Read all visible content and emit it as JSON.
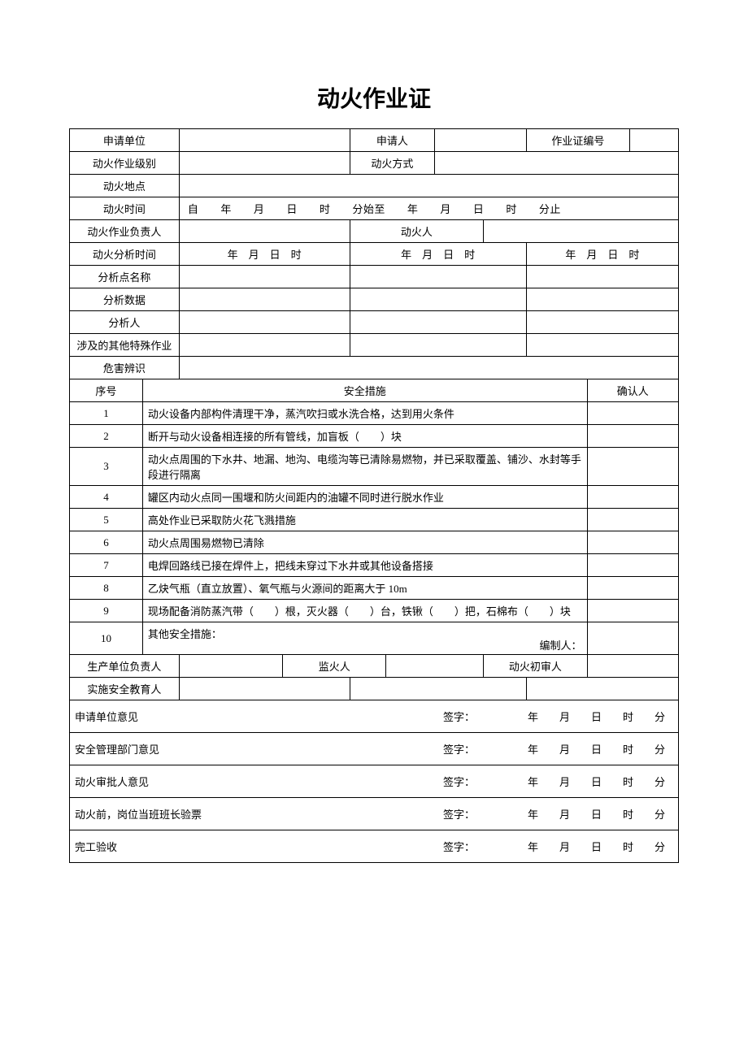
{
  "title": "动火作业证",
  "labels": {
    "applicant_unit": "申请单位",
    "applicant": "申请人",
    "permit_no": "作业证编号",
    "level": "动火作业级别",
    "method": "动火方式",
    "location": "动火地点",
    "time": "动火时间",
    "time_val": "自  年  月  日  时  分始至  年  月  日  时  分止",
    "person_in_charge": "动火作业负责人",
    "fire_person": "动火人",
    "analysis_time": "动火分析时间",
    "at_val": "年 月 日 时",
    "analysis_point": "分析点名称",
    "analysis_data": "分析数据",
    "analyst": "分析人",
    "other_special": "涉及的其他特殊作业",
    "hazard": "危害辨识",
    "seq": "序号",
    "measure": "安全措施",
    "confirmer": "确认人",
    "prod_unit_person": "生产单位负责人",
    "supervisor": "监火人",
    "first_reviewer": "动火初审人",
    "safety_educator": "实施安全教育人",
    "applicant_opinion": "申请单位意见",
    "safety_dept_opinion": "安全管理部门意见",
    "approver_opinion": "动火审批人意见",
    "pre_check": "动火前，岗位当班班长验票",
    "completion": "完工验收",
    "sig_suffix": "签字：     年  月  日  时  分",
    "preparer": "编制人："
  },
  "measures": {
    "m1": "动火设备内部构件清理干净，蒸汽吹扫或水洗合格，达到用火条件",
    "m2": "断开与动火设备相连接的所有管线，加盲板（  ）块",
    "m3": "动火点周围的下水井、地漏、地沟、电缆沟等已清除易燃物，并已采取覆盖、铺沙、水封等手段进行隔离",
    "m4": "罐区内动火点同一围堰和防火间距内的油罐不同时进行脱水作业",
    "m5": "高处作业已采取防火花飞溅措施",
    "m6": "动火点周围易燃物已清除",
    "m7": "电焊回路线已接在焊件上，把线未穿过下水井或其他设备搭接",
    "m8": "乙炔气瓶（直立放置）、氧气瓶与火源间的距离大于 10m",
    "m9": "现场配备消防蒸汽带（  ）根，灭火器（  ）台，铁锹（  ）把，石棉布（  ）块",
    "m10": "其他安全措施："
  },
  "nums": {
    "n1": "1",
    "n2": "2",
    "n3": "3",
    "n4": "4",
    "n5": "5",
    "n6": "6",
    "n7": "7",
    "n8": "8",
    "n9": "9",
    "n10": "10"
  }
}
